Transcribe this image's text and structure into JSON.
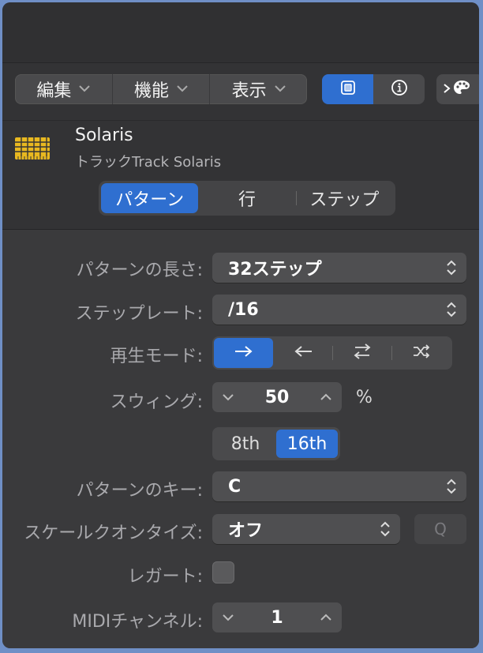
{
  "toolbar": {
    "menus": [
      {
        "label": "編集"
      },
      {
        "label": "機能"
      },
      {
        "label": "表示"
      }
    ],
    "view_buttons": [
      {
        "icon": "step-sequencer-icon",
        "active": true
      },
      {
        "icon": "info-icon",
        "active": false
      }
    ],
    "extra_button_icon": "palette-icon"
  },
  "track": {
    "name": "Solaris",
    "subtitle": "トラックTrack Solaris",
    "icon": "step-sequencer-grid-icon",
    "icon_color": "#e8b820"
  },
  "tabs": [
    {
      "label": "パターン",
      "active": true
    },
    {
      "label": "行",
      "active": false
    },
    {
      "label": "ステップ",
      "active": false
    }
  ],
  "inspector": {
    "pattern_length": {
      "label": "パターンの長さ:",
      "value": "32ステップ"
    },
    "step_rate": {
      "label": "ステップレート:",
      "value": "/16"
    },
    "playback_mode": {
      "label": "再生モード:",
      "options": [
        {
          "icon": "forward-arrow-icon",
          "active": true
        },
        {
          "icon": "reverse-arrow-icon",
          "active": false
        },
        {
          "icon": "ping-pong-icon",
          "active": false
        },
        {
          "icon": "random-shuffle-icon",
          "active": false
        }
      ]
    },
    "swing": {
      "label": "スウィング:",
      "value": "50",
      "unit": "%"
    },
    "swing_resolution": [
      {
        "label": "8th",
        "active": false
      },
      {
        "label": "16th",
        "active": true
      }
    ],
    "pattern_key": {
      "label": "パターンのキー:",
      "value": "C"
    },
    "scale_quantize": {
      "label": "スケールクオンタイズ:",
      "value": "オフ",
      "q_label": "Q"
    },
    "legato": {
      "label": "レガート:",
      "checked": false
    },
    "midi_channel": {
      "label": "MIDIチャンネル:",
      "value": "1"
    }
  },
  "colors": {
    "accent": "#2f6fd0",
    "panel": "#3a3a3c",
    "control": "#4f4f51"
  }
}
